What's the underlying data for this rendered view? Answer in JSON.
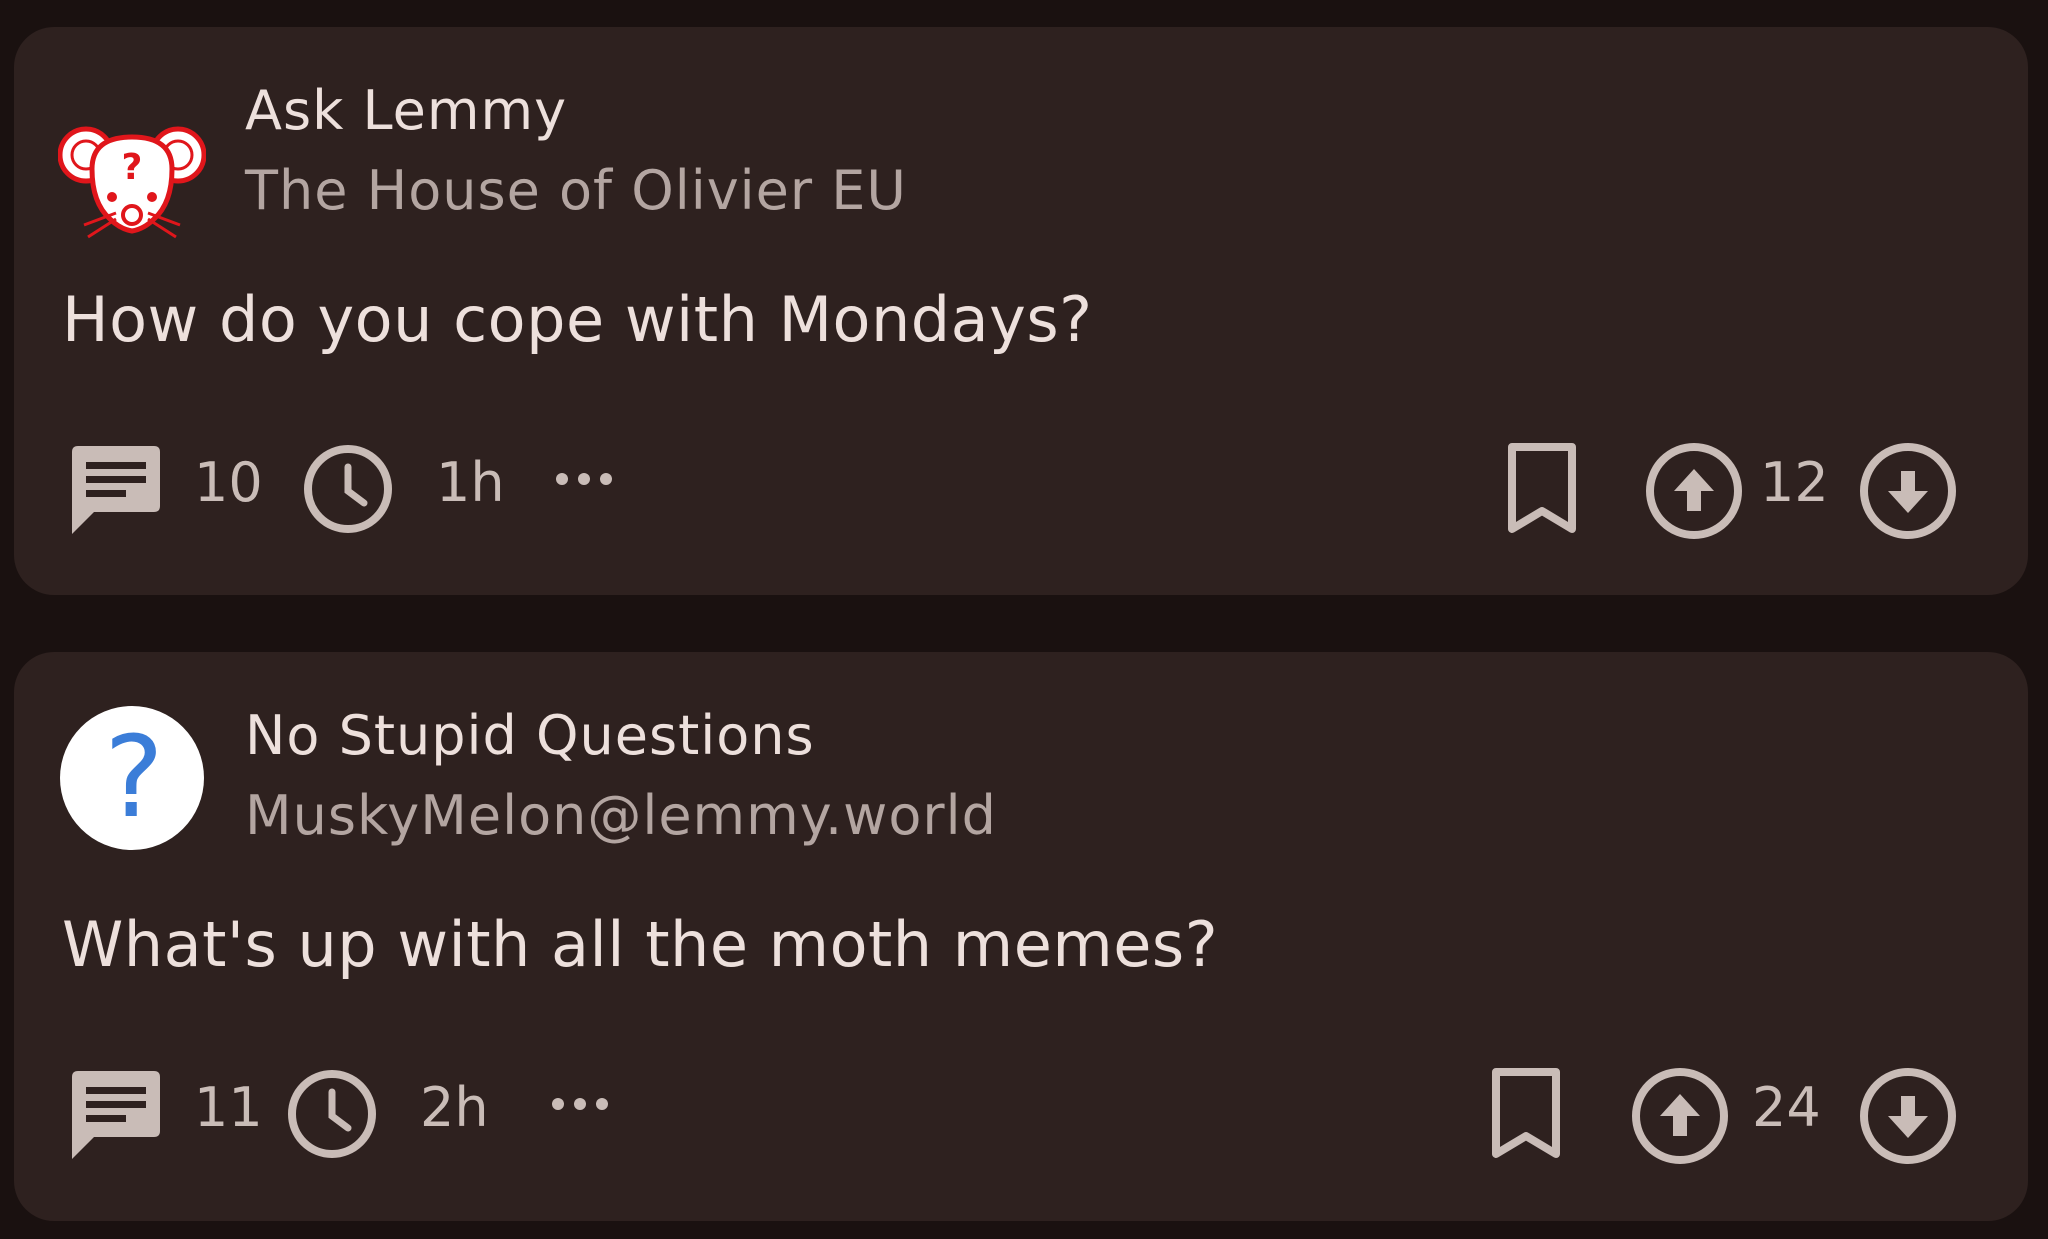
{
  "posts": [
    {
      "community": "Ask Lemmy",
      "subtitle": "The House of Olivier EU",
      "title": "How do you cope with Mondays?",
      "comments": "10",
      "age": "1h",
      "score": "12",
      "avatar_icon": "ask-lemmy-mouse-icon"
    },
    {
      "community": "No Stupid Questions",
      "subtitle": "MuskyMelon@lemmy.world",
      "title": "What's up with all the moth memes?",
      "comments": "11",
      "age": "2h",
      "score": "24",
      "avatar_icon": "question-mark-icon"
    }
  ],
  "colors": {
    "background": "#1a1110",
    "card": "#2e211f",
    "text_primary": "#ede0dc",
    "text_secondary": "#b3a5a1",
    "icon": "#c9bcb7",
    "ask_lemmy_red": "#e0161b",
    "question_blue": "#3b7dd8"
  }
}
